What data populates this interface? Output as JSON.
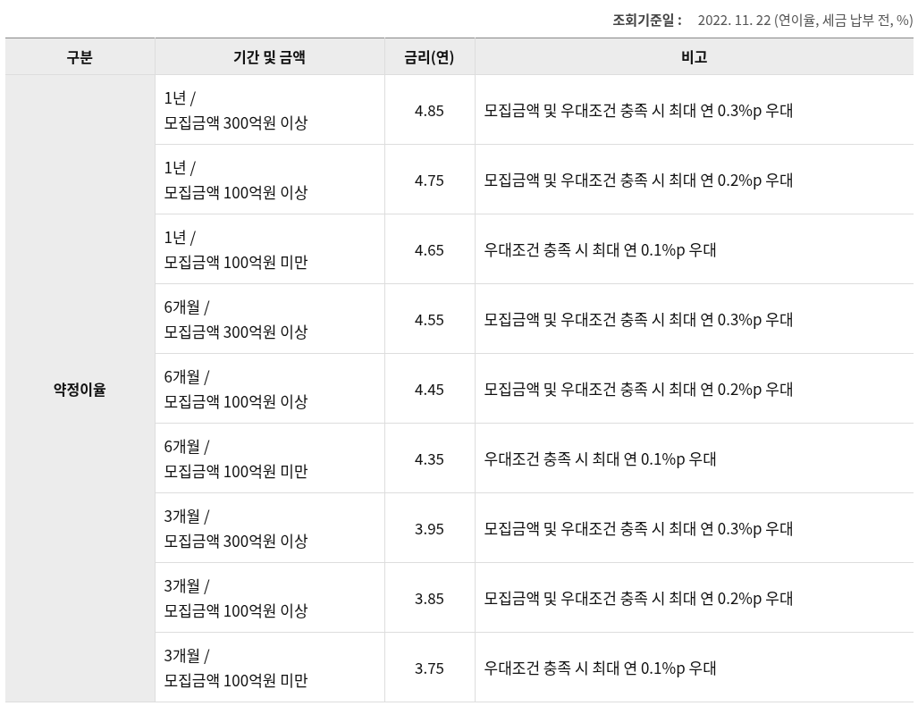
{
  "reference": {
    "label": "조회기준일 :",
    "value": "2022. 11. 22 (연이율, 세금 납부 전, %)"
  },
  "table": {
    "columns": [
      "구분",
      "기간 및 금액",
      "금리(연)",
      "비고"
    ],
    "category": "약정이율",
    "rows": [
      {
        "period": "1년 /",
        "amount": "모집금액 300억원 이상",
        "rate": "4.85",
        "note": "모집금액 및 우대조건 충족 시 최대 연 0.3%p 우대"
      },
      {
        "period": "1년 /",
        "amount": "모집금액 100억원 이상",
        "rate": "4.75",
        "note": "모집금액 및 우대조건 충족 시 최대 연 0.2%p 우대"
      },
      {
        "period": "1년 /",
        "amount": "모집금액 100억원 미만",
        "rate": "4.65",
        "note": "우대조건 충족 시 최대 연 0.1%p 우대"
      },
      {
        "period": "6개월 /",
        "amount": "모집금액 300억원 이상",
        "rate": "4.55",
        "note": "모집금액 및 우대조건 충족 시 최대 연 0.3%p 우대"
      },
      {
        "period": "6개월 /",
        "amount": "모집금액 100억원 이상",
        "rate": "4.45",
        "note": "모집금액 및 우대조건 충족 시 최대 연 0.2%p 우대"
      },
      {
        "period": "6개월 /",
        "amount": "모집금액 100억원 미만",
        "rate": "4.35",
        "note": "우대조건 충족 시 최대 연 0.1%p 우대"
      },
      {
        "period": "3개월 /",
        "amount": "모집금액 300억원 이상",
        "rate": "3.95",
        "note": "모집금액 및 우대조건 충족 시 최대 연 0.3%p 우대"
      },
      {
        "period": "3개월 /",
        "amount": "모집금액 100억원 이상",
        "rate": "3.85",
        "note": "모집금액 및 우대조건 충족 시 최대 연 0.2%p 우대"
      },
      {
        "period": "3개월 /",
        "amount": "모집금액 100억원 미만",
        "rate": "3.75",
        "note": "우대조건 충족 시 최대 연 0.1%p 우대"
      }
    ]
  }
}
